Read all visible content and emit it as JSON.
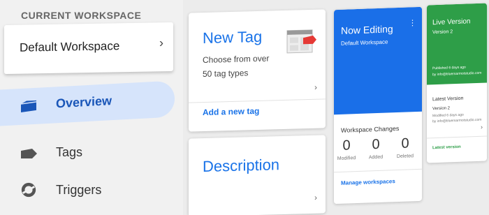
{
  "sidebar": {
    "workspace_label": "CURRENT WORKSPACE",
    "workspace_name": "Default Workspace",
    "items": [
      {
        "label": "Overview",
        "icon": "overview-icon",
        "active": true
      },
      {
        "label": "Tags",
        "icon": "tag-icon",
        "active": false
      },
      {
        "label": "Triggers",
        "icon": "trigger-icon",
        "active": false
      }
    ]
  },
  "new_tag": {
    "title": "New Tag",
    "description": "Choose from over 50 tag types",
    "action": "Add a new tag"
  },
  "description_card": {
    "title": "Description"
  },
  "now_editing": {
    "title": "Now Editing",
    "subtitle": "Default Workspace",
    "changes_title": "Workspace Changes",
    "stats": [
      {
        "value": "0",
        "label": "Modified"
      },
      {
        "value": "0",
        "label": "Added"
      },
      {
        "value": "0",
        "label": "Deleted"
      }
    ],
    "action": "Manage workspaces"
  },
  "live_version": {
    "title": "Live Version",
    "subtitle": "Version 2",
    "published_line1": "Published 6 days ago",
    "published_line2": "by info@bluemarmotstudio.com",
    "latest_title": "Latest Version",
    "latest_version": "Version 2",
    "modified_line1": "Modified 6 days ago",
    "modified_line2": "by info@bluemarmotstudio.com",
    "action": "Latest version"
  },
  "colors": {
    "accent_blue": "#1a73e8",
    "editing_header": "#1a6fe8",
    "live_header": "#2e9e48",
    "active_nav_bg": "#d6e4fb"
  }
}
